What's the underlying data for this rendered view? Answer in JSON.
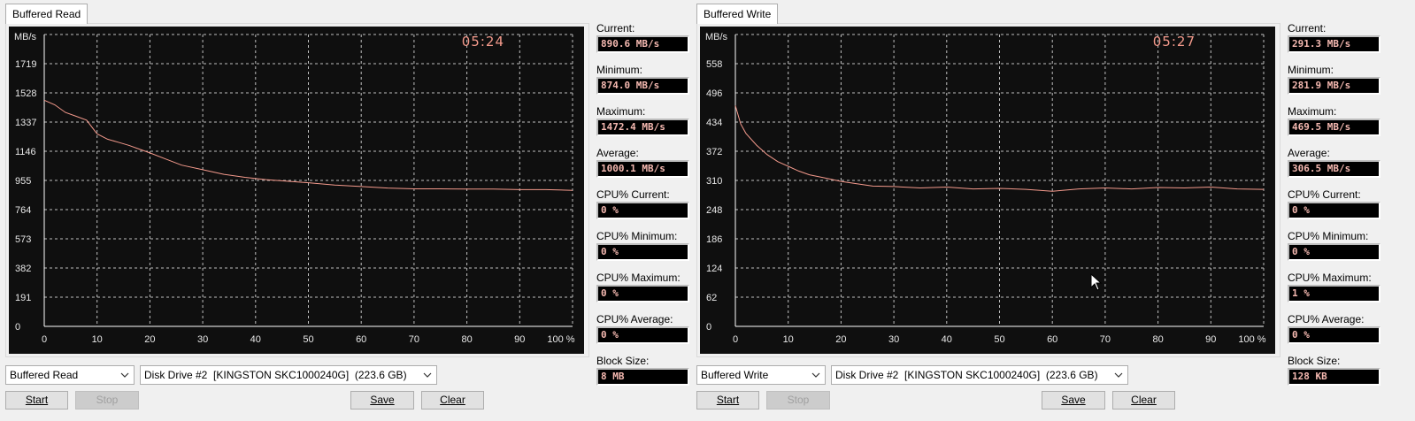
{
  "colors": {
    "chart_bg": "#0f0f0f",
    "grid": "#bfbfbf",
    "trace": "#f49a8c",
    "axis_text": "#e8e8e8",
    "value_text": "#f4b8b0"
  },
  "panels": [
    {
      "tab": "Buffered Read",
      "clock": "05:24",
      "unit": "MB/s",
      "stats": {
        "current_label": "Current:",
        "current": "890.6 MB/s",
        "minimum_label": "Minimum:",
        "minimum": "874.0 MB/s",
        "maximum_label": "Maximum:",
        "maximum": "1472.4 MB/s",
        "average_label": "Average:",
        "average": "1000.1 MB/s",
        "cpu_current_label": "CPU% Current:",
        "cpu_current": "0 %",
        "cpu_minimum_label": "CPU% Minimum:",
        "cpu_minimum": "0 %",
        "cpu_maximum_label": "CPU% Maximum:",
        "cpu_maximum": "0 %",
        "cpu_average_label": "CPU% Average:",
        "cpu_average": "0 %",
        "block_label": "Block Size:",
        "block": "8 MB"
      },
      "mode_select": "Buffered Read",
      "drive_select": "Disk Drive #2  [KINGSTON SKC1000240G]  (223.6 GB)",
      "buttons": {
        "start": "Start",
        "stop": "Stop",
        "save": "Save",
        "clear": "Clear"
      }
    },
    {
      "tab": "Buffered Write",
      "clock": "05:27",
      "unit": "MB/s",
      "stats": {
        "current_label": "Current:",
        "current": "291.3 MB/s",
        "minimum_label": "Minimum:",
        "minimum": "281.9 MB/s",
        "maximum_label": "Maximum:",
        "maximum": "469.5 MB/s",
        "average_label": "Average:",
        "average": "306.5 MB/s",
        "cpu_current_label": "CPU% Current:",
        "cpu_current": "0 %",
        "cpu_minimum_label": "CPU% Minimum:",
        "cpu_minimum": "0 %",
        "cpu_maximum_label": "CPU% Maximum:",
        "cpu_maximum": "1 %",
        "cpu_average_label": "CPU% Average:",
        "cpu_average": "0 %",
        "block_label": "Block Size:",
        "block": "128 KB"
      },
      "mode_select": "Buffered Write",
      "drive_select": "Disk Drive #2  [KINGSTON SKC1000240G]  (223.6 GB)",
      "buttons": {
        "start": "Start",
        "stop": "Stop",
        "save": "Save",
        "clear": "Clear"
      }
    }
  ],
  "chart_data": [
    {
      "type": "line",
      "ylabel": "MB/s",
      "yticks": [
        "0",
        "191",
        "382",
        "573",
        "764",
        "955",
        "1146",
        "1337",
        "1528",
        "1719"
      ],
      "ylim": [
        0,
        1910
      ],
      "xticks": [
        "0",
        "10",
        "20",
        "30",
        "40",
        "50",
        "60",
        "70",
        "80",
        "90",
        "100 %"
      ],
      "xlim": [
        0,
        100
      ],
      "grid": true,
      "series": [
        {
          "x": [
            0,
            2,
            4,
            6,
            8,
            10,
            12,
            14,
            16,
            18,
            20,
            23,
            26,
            30,
            34,
            38,
            42,
            46,
            50,
            55,
            60,
            65,
            70,
            75,
            80,
            85,
            90,
            95,
            100
          ],
          "values": [
            1480,
            1450,
            1400,
            1375,
            1350,
            1260,
            1225,
            1205,
            1185,
            1160,
            1135,
            1095,
            1055,
            1025,
            995,
            975,
            960,
            950,
            940,
            925,
            915,
            905,
            900,
            900,
            898,
            898,
            895,
            895,
            890
          ]
        }
      ]
    },
    {
      "type": "line",
      "ylabel": "MB/s",
      "yticks": [
        "0",
        "62",
        "124",
        "186",
        "248",
        "310",
        "372",
        "434",
        "496",
        "558"
      ],
      "ylim": [
        0,
        620
      ],
      "xticks": [
        "0",
        "10",
        "20",
        "30",
        "40",
        "50",
        "60",
        "70",
        "80",
        "90",
        "100 %"
      ],
      "xlim": [
        0,
        100
      ],
      "grid": true,
      "series": [
        {
          "x": [
            0,
            1,
            2,
            4,
            6,
            8,
            10,
            12,
            14,
            17,
            20,
            23,
            26,
            30,
            35,
            40,
            45,
            50,
            55,
            60,
            65,
            70,
            75,
            80,
            85,
            90,
            95,
            100
          ],
          "values": [
            469,
            430,
            410,
            385,
            365,
            350,
            340,
            330,
            322,
            315,
            308,
            303,
            298,
            297,
            294,
            296,
            292,
            293,
            291,
            287,
            292,
            294,
            292,
            295,
            294,
            296,
            292,
            291
          ]
        }
      ]
    }
  ]
}
